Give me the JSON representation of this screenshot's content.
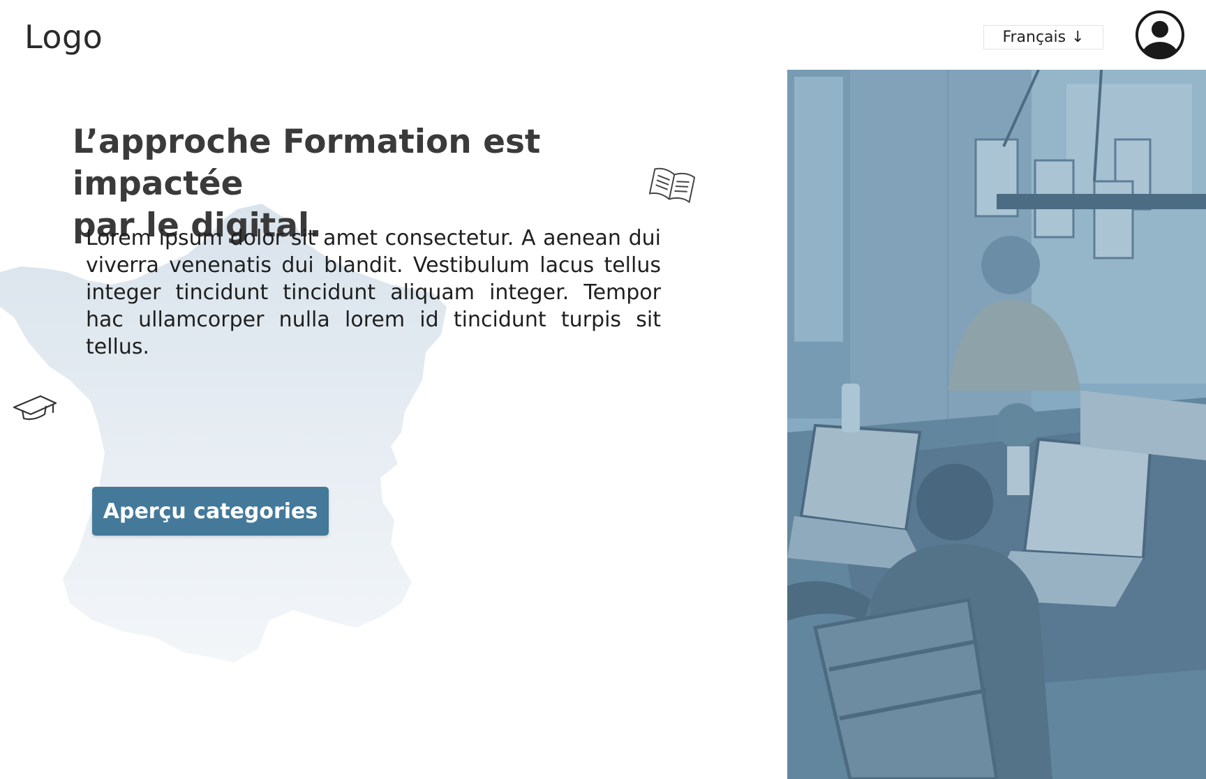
{
  "header": {
    "logo_text": "Logo",
    "language": {
      "selected": "Français",
      "arrow": "↓"
    },
    "avatar_icon": "user-circle-icon"
  },
  "hero": {
    "headline_line1": "L’approche Formation est impactée",
    "headline_line2": "par le digital.",
    "body": "Lorem ipsum dolor sit amet consectetur. A aenean dui viverra venenatis dui blandit. Vestibulum lacus tellus integer tincidunt tincidunt aliquam integer. Tempor hac ullamcorper nulla lorem id tincidunt turpis sit tellus.",
    "cta_label": "Aperçu categories"
  },
  "icons": {
    "book": "open-book-icon",
    "cap": "graduation-cap-icon"
  },
  "colors": {
    "accent": "#44799a",
    "map_tint": "#dfe8f0",
    "photo_overlay": "#6f9bb6"
  }
}
